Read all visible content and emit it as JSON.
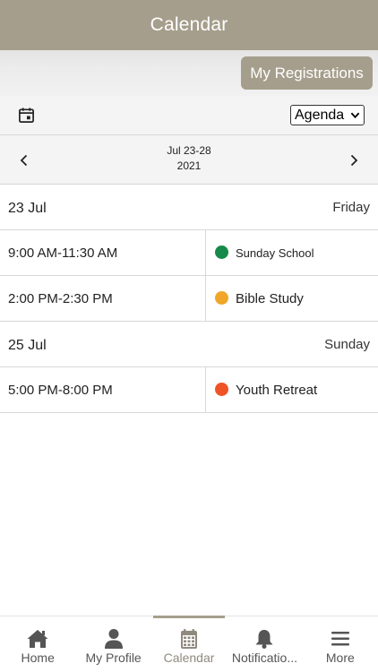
{
  "header": {
    "title": "Calendar"
  },
  "registrations": {
    "label": "My Registrations"
  },
  "toolbar": {
    "view_selected": "Agenda"
  },
  "nav": {
    "range_line1": "Jul 23-28",
    "range_line2": "2021"
  },
  "days": [
    {
      "date": "23 Jul",
      "weekday": "Friday",
      "events": [
        {
          "time": "9:00 AM-11:30 AM",
          "title": "Sunday School",
          "color": "#168a4a"
        },
        {
          "time": "2:00 PM-2:30 PM",
          "title": "Bible Study",
          "color": "#f0a629"
        }
      ]
    },
    {
      "date": "25 Jul",
      "weekday": "Sunday",
      "events": [
        {
          "time": "5:00 PM-8:00 PM",
          "title": "Youth Retreat",
          "color": "#ef5426"
        }
      ]
    }
  ],
  "tabs": [
    {
      "label": "Home",
      "icon": "home-icon"
    },
    {
      "label": "My Profile",
      "icon": "person-icon"
    },
    {
      "label": "Calendar",
      "icon": "calendar-icon"
    },
    {
      "label": "Notificatio...",
      "icon": "bell-icon"
    },
    {
      "label": "More",
      "icon": "menu-icon"
    }
  ],
  "colors": {
    "accent": "#a59e8c",
    "active_tab_label": "#8f8a7e"
  }
}
